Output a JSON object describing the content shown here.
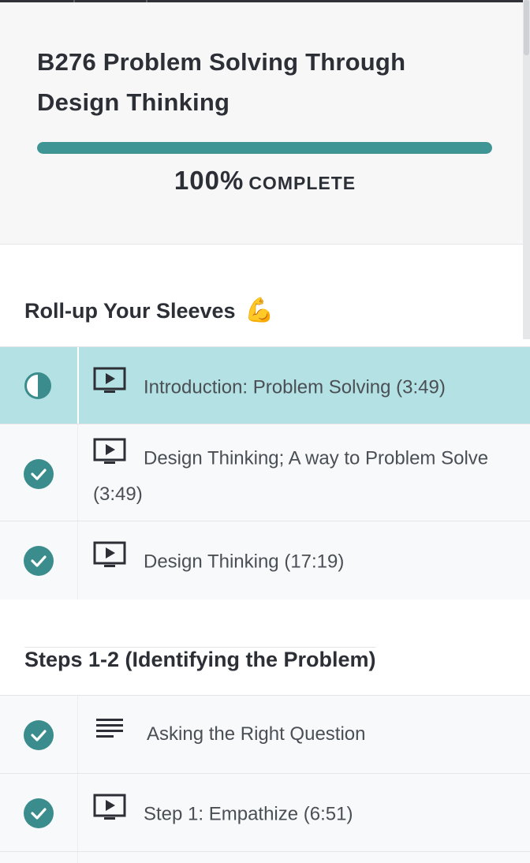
{
  "course": {
    "title": "B276 Problem Solving Through Design Thinking",
    "progress_percent": 100,
    "progress_value": "100%",
    "progress_label": "COMPLETE"
  },
  "colors": {
    "accent": "#3f9494",
    "active_row": "#b4e1e3"
  },
  "sections": [
    {
      "title": "Roll-up Your Sleeves",
      "emoji": "💪",
      "lessons": [
        {
          "title": "Introduction: Problem Solving (3:49)",
          "type": "video-icon",
          "status": "in-progress"
        },
        {
          "title": "Design Thinking; A way to Problem Solve (3:49)",
          "type": "video-icon",
          "status": "complete"
        },
        {
          "title": "Design Thinking (17:19)",
          "type": "video-icon",
          "status": "complete"
        }
      ]
    },
    {
      "title": "Steps 1-2 (Identifying the Problem)",
      "lessons": [
        {
          "title": "Asking the Right Question",
          "type": "text-icon",
          "status": "complete"
        },
        {
          "title": "Step 1: Empathize (6:51)",
          "type": "video-icon",
          "status": "complete"
        }
      ]
    }
  ]
}
